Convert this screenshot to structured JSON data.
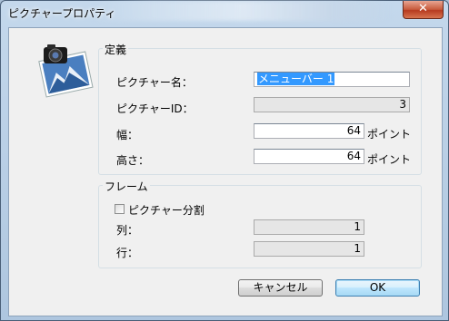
{
  "window": {
    "title": "ピクチャープロパティ",
    "close_glyph": "✕"
  },
  "definition": {
    "group_title": "定義",
    "picture_name_label": "ピクチャー名：",
    "picture_name_value": "メニューバー 1",
    "picture_id_label": "ピクチャーID：",
    "picture_id_value": "3",
    "width_label": "幅：",
    "width_value": "64",
    "width_unit": "ポイント",
    "height_label": "高さ：",
    "height_value": "64",
    "height_unit": "ポイント"
  },
  "frame": {
    "group_title": "フレーム",
    "split_checkbox_label": "ピクチャー分割",
    "split_checked": false,
    "columns_label": "列：",
    "columns_value": "1",
    "rows_label": "行：",
    "rows_value": "1"
  },
  "buttons": {
    "cancel": "キャンセル",
    "ok": "OK"
  },
  "icons": {
    "app": "camera-picture-icon",
    "checkbox": "checkbox-icon"
  }
}
